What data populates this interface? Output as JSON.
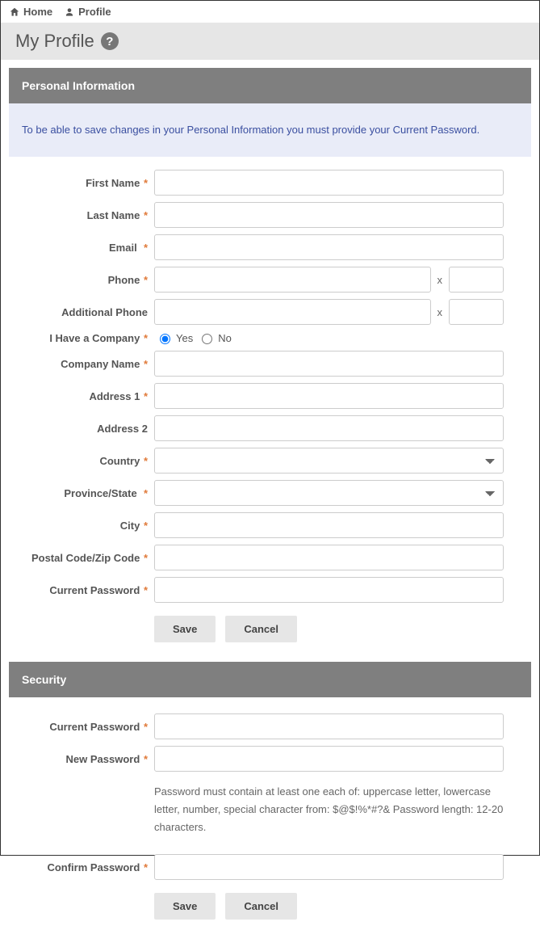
{
  "nav": {
    "home": "Home",
    "profile": "Profile"
  },
  "page_title": "My Profile",
  "help_icon_label": "?",
  "personal": {
    "header": "Personal Information",
    "banner": "To be able to save changes in your Personal Information you must provide your Current Password.",
    "fields": {
      "first_name": "First Name",
      "last_name": "Last Name",
      "email": "Email",
      "phone": "Phone",
      "phone_ext_sep": "x",
      "add_phone": "Additional Phone",
      "have_company": "I Have a Company",
      "yes": "Yes",
      "no": "No",
      "company": "Company Name",
      "address1": "Address 1",
      "address2": "Address 2",
      "country": "Country",
      "province": "Province/State",
      "city": "City",
      "postal": "Postal Code/Zip Code",
      "current_password": "Current Password"
    },
    "have_company_value": "yes",
    "buttons": {
      "save": "Save",
      "cancel": "Cancel"
    }
  },
  "security": {
    "header": "Security",
    "fields": {
      "current_password": "Current Password",
      "new_password": "New Password",
      "confirm_password": "Confirm Password"
    },
    "hint": "Password must contain at least one each of: uppercase letter, lowercase letter, number, special character from: $@$!%*#?& Password length: 12-20 characters.",
    "buttons": {
      "save": "Save",
      "cancel": "Cancel"
    }
  },
  "required_mark": "*"
}
